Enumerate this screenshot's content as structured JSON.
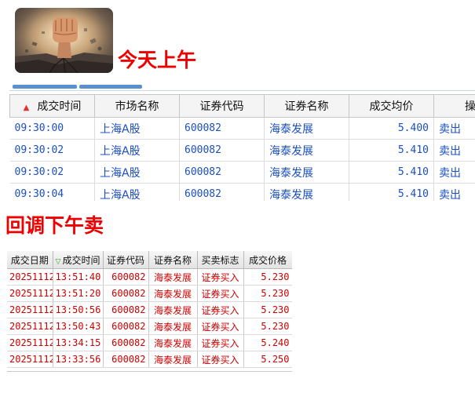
{
  "heading_top": "今天上午",
  "heading_bottom": "回调下午卖",
  "table_top": {
    "columns": [
      "成交时间",
      "市场名称",
      "证券代码",
      "证券名称",
      "成交均价",
      "操作"
    ],
    "rows": [
      {
        "time": "09:30:00",
        "market": "上海A股",
        "code": "600082",
        "name": "海泰发展",
        "price": "5.400",
        "action": "卖出"
      },
      {
        "time": "09:30:02",
        "market": "上海A股",
        "code": "600082",
        "name": "海泰发展",
        "price": "5.410",
        "action": "卖出"
      },
      {
        "time": "09:30:02",
        "market": "上海A股",
        "code": "600082",
        "name": "海泰发展",
        "price": "5.410",
        "action": "卖出"
      },
      {
        "time": "09:30:04",
        "market": "上海A股",
        "code": "600082",
        "name": "海泰发展",
        "price": "5.410",
        "action": "卖出"
      }
    ]
  },
  "table_bottom": {
    "columns": [
      "成交日期",
      "成交时间",
      "证券代码",
      "证券名称",
      "买卖标志",
      "成交价格"
    ],
    "rows": [
      {
        "date": "20251112",
        "time": "13:51:40",
        "code": "600082",
        "name": "海泰发展",
        "flag": "证券买入",
        "price": "5.230"
      },
      {
        "date": "20251112",
        "time": "13:51:20",
        "code": "600082",
        "name": "海泰发展",
        "flag": "证券买入",
        "price": "5.230"
      },
      {
        "date": "20251112",
        "time": "13:50:56",
        "code": "600082",
        "name": "海泰发展",
        "flag": "证券买入",
        "price": "5.230"
      },
      {
        "date": "20251112",
        "time": "13:50:43",
        "code": "600082",
        "name": "海泰发展",
        "flag": "证券买入",
        "price": "5.230"
      },
      {
        "date": "20251112",
        "time": "13:34:15",
        "code": "600082",
        "name": "海泰发展",
        "flag": "证券买入",
        "price": "5.240"
      },
      {
        "date": "20251112",
        "time": "13:33:56",
        "code": "600082",
        "name": "海泰发展",
        "flag": "证券买入",
        "price": "5.250"
      }
    ]
  }
}
